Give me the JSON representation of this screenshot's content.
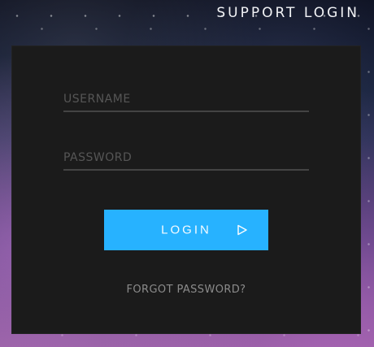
{
  "header": {
    "title": "SUPPORT LOGIN"
  },
  "login_form": {
    "username": {
      "placeholder": "USERNAME",
      "value": ""
    },
    "password": {
      "placeholder": "PASSWORD",
      "value": ""
    },
    "submit_label": "LOGIN",
    "submit_icon": "play-arrow-icon",
    "forgot_password_label": "FORGOT PASSWORD?"
  },
  "colors": {
    "accent": "#27b2ff",
    "panel_background": "#1b1b1b",
    "field_line": "#444444",
    "muted_text": "#8b8b8b"
  }
}
